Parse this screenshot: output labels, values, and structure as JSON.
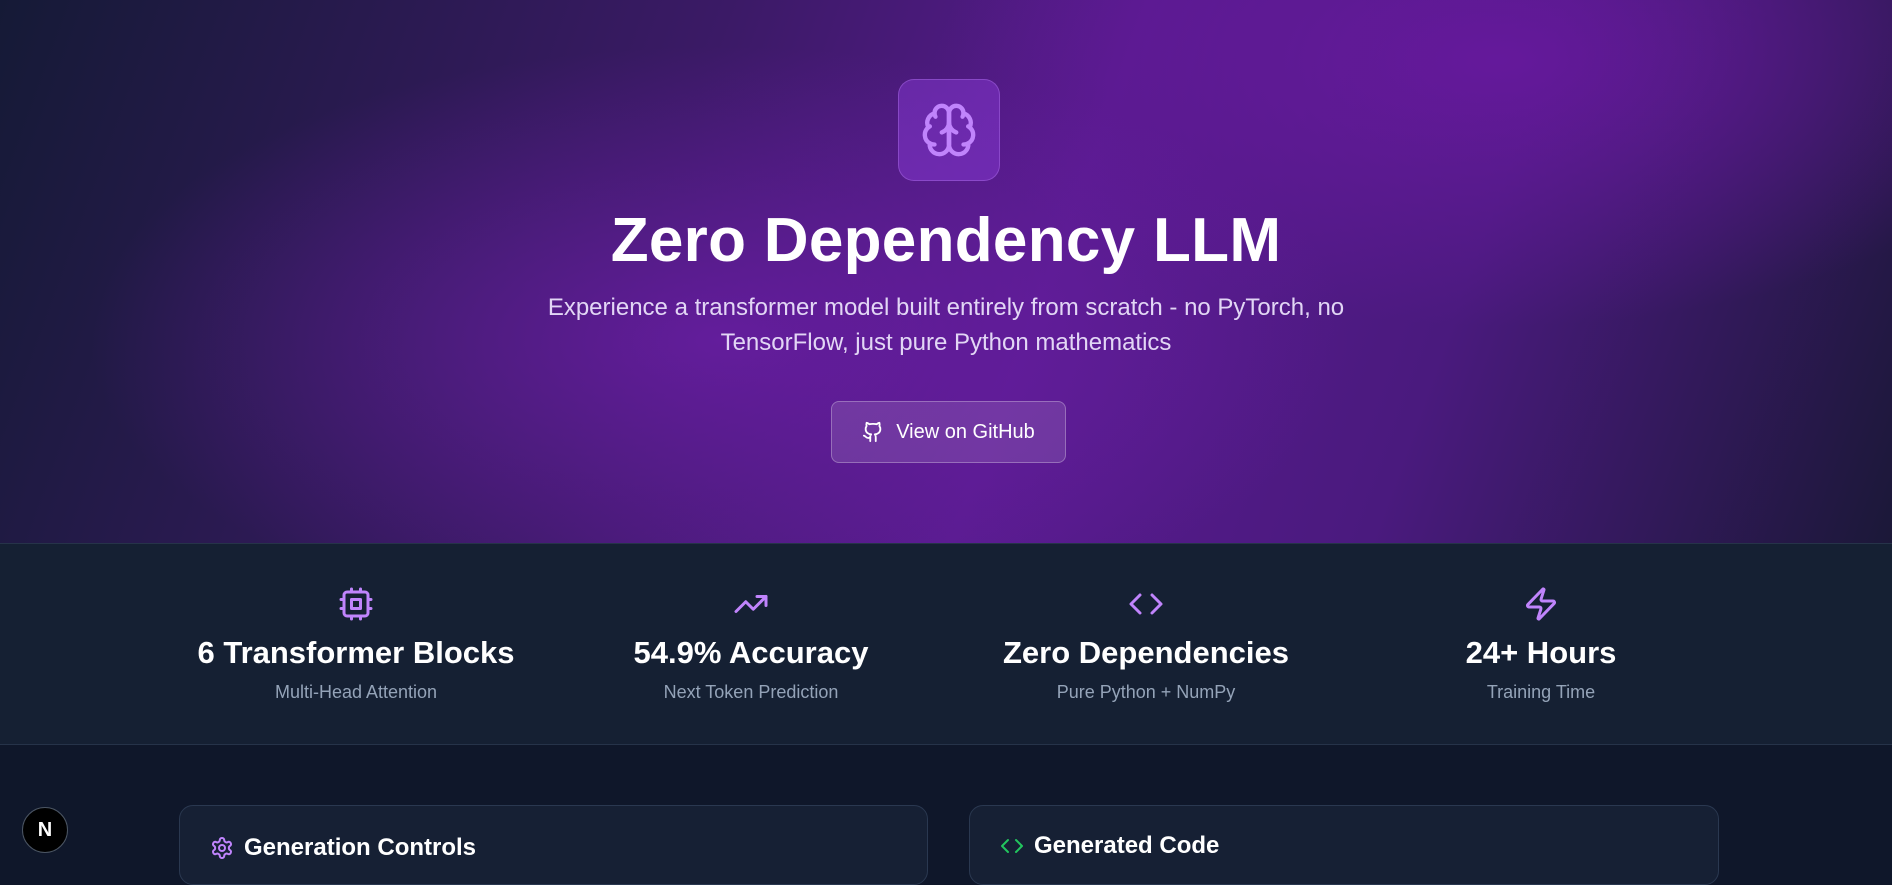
{
  "hero": {
    "icon": "brain-icon",
    "title": "Zero Dependency LLM",
    "subtitle": "Experience a transformer model built entirely from scratch - no PyTorch, no TensorFlow, just pure Python mathematics",
    "github_button": {
      "icon": "github-icon",
      "label": "View on GitHub"
    }
  },
  "stats": [
    {
      "icon": "cpu-icon",
      "value": "6 Transformer Blocks",
      "label": "Multi-Head Attention"
    },
    {
      "icon": "trending-up-icon",
      "value": "54.9% Accuracy",
      "label": "Next Token Prediction"
    },
    {
      "icon": "code-icon",
      "value": "Zero Dependencies",
      "label": "Pure Python + NumPy"
    },
    {
      "icon": "zap-icon",
      "value": "24+ Hours",
      "label": "Training Time"
    }
  ],
  "panels": {
    "generation_controls": {
      "icon": "settings-icon",
      "title": "Generation Controls"
    },
    "generated_code": {
      "icon": "code-icon",
      "title": "Generated Code"
    }
  },
  "nextjs_badge": {
    "letter": "N"
  },
  "colors": {
    "accent_purple": "#c084fc",
    "accent_green": "#22c55e",
    "muted_text": "#94a3b8",
    "page_background": "#0f172a"
  }
}
